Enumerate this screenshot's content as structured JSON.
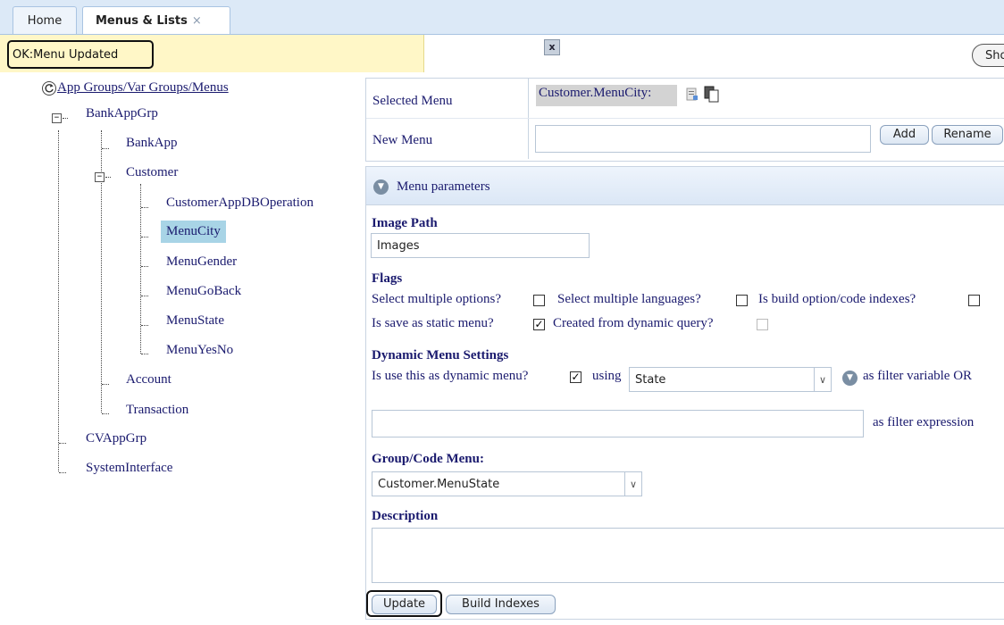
{
  "tabs": [
    {
      "label": "Home"
    },
    {
      "label": "Menus & Lists",
      "close": "×"
    }
  ],
  "message": {
    "text": "OK:Menu Updated",
    "close_icon": "x",
    "show_label": "Sho"
  },
  "tree": {
    "root": "App Groups/Var Groups/Menus",
    "groups": [
      {
        "label": "BankAppGrp"
      },
      {
        "label": "BankApp"
      },
      {
        "label": "Customer"
      },
      {
        "label": "CustomerAppDBOperation"
      },
      {
        "label": "MenuCity"
      },
      {
        "label": "MenuGender"
      },
      {
        "label": "MenuGoBack"
      },
      {
        "label": "MenuState"
      },
      {
        "label": "MenuYesNo"
      },
      {
        "label": "Account"
      },
      {
        "label": "Transaction"
      },
      {
        "label": "CVAppGrp"
      },
      {
        "label": "SystemInterface"
      }
    ]
  },
  "menu": {
    "selected_label": "Selected Menu",
    "selected_value": "Customer.MenuCity:",
    "new_label": "New Menu",
    "new_value": "",
    "add_label": "Add",
    "rename_label": "Rename"
  },
  "params": {
    "header": "Menu parameters",
    "image_path_label": "Image Path",
    "image_path_value": "Images",
    "flags_label": "Flags",
    "flag_multi_options": "Select multiple options?",
    "flag_multi_languages": "Select multiple languages?",
    "flag_build_indexes": "Is build option/code indexes?",
    "flag_static": "Is save as static menu?",
    "flag_dynamic_query": "Created from dynamic query?",
    "dynamic_label": "Dynamic Menu Settings",
    "dynamic_use": "Is use this as dynamic menu?",
    "using_label": "using",
    "using_value": "State",
    "filter_var_label": "as filter variable OR",
    "filter_expr_value": "",
    "filter_expr_label": "as filter expression",
    "group_code_label": "Group/Code Menu:",
    "group_code_value": "Customer.MenuState",
    "description_label": "Description",
    "description_value": "",
    "update_label": "Update",
    "build_indexes_label": "Build Indexes"
  }
}
